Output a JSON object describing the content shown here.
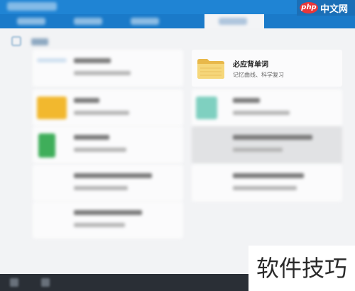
{
  "watermark": {
    "top_badge": "php",
    "top_text": "中文网",
    "bottom_text": "软件技巧"
  },
  "cards": {
    "memorize_words": {
      "title": "必应背单词",
      "subtitle": "记忆曲线、科学复习"
    }
  },
  "colors": {
    "header_blue": "#1a7ac9",
    "content_bg": "#f2f3f5",
    "footer_dark": "#2a2f36"
  }
}
